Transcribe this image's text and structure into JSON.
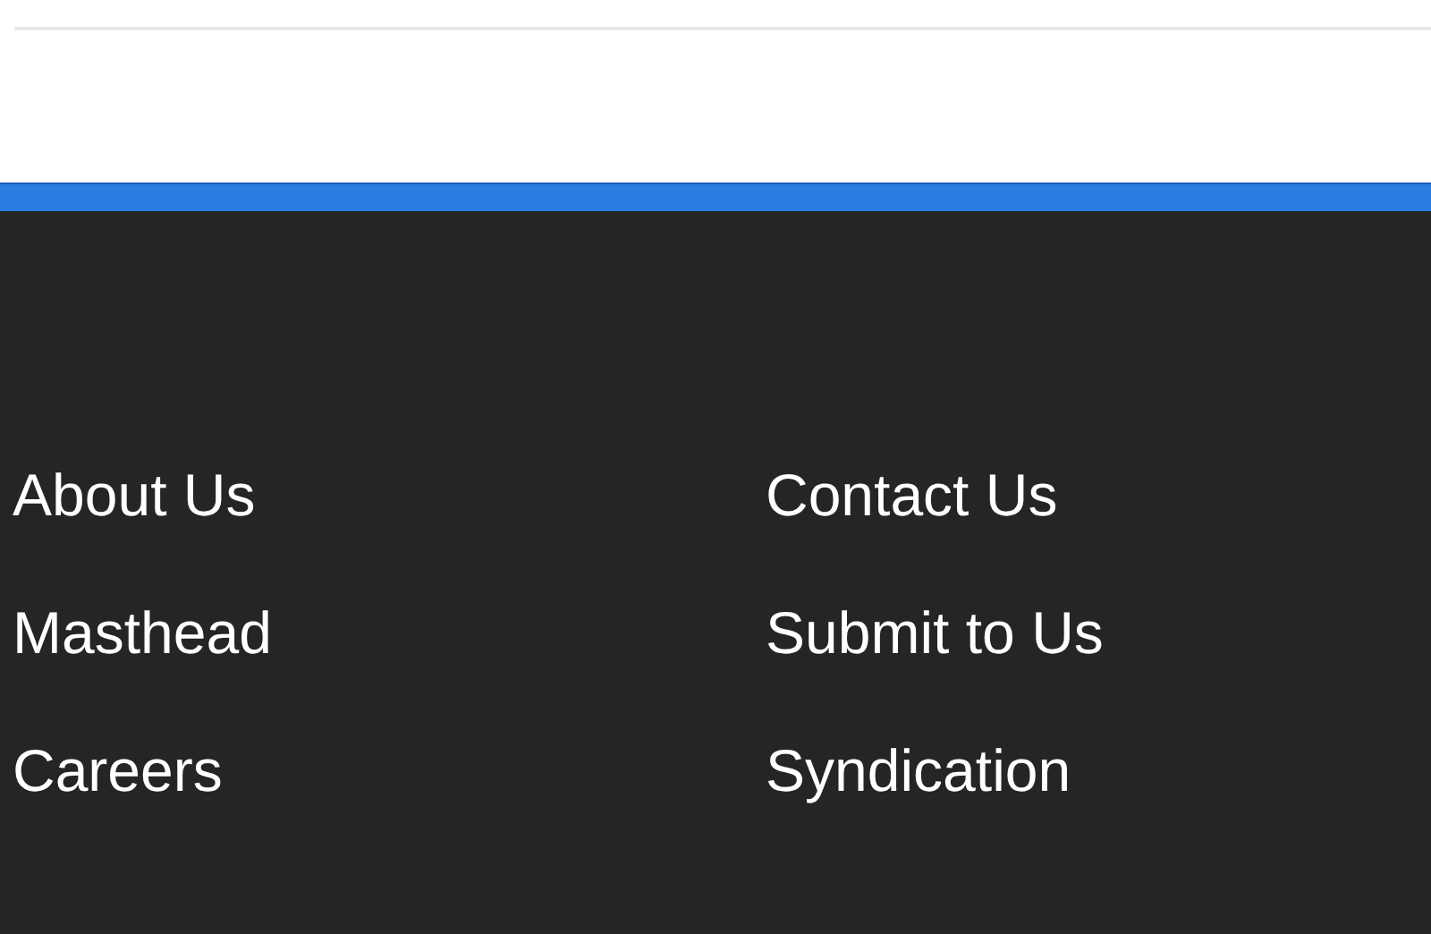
{
  "footer": {
    "links": [
      {
        "label": "About Us"
      },
      {
        "label": "Contact Us"
      },
      {
        "label": "Masthead"
      },
      {
        "label": "Submit to Us"
      },
      {
        "label": "Careers"
      },
      {
        "label": "Syndication"
      }
    ]
  }
}
